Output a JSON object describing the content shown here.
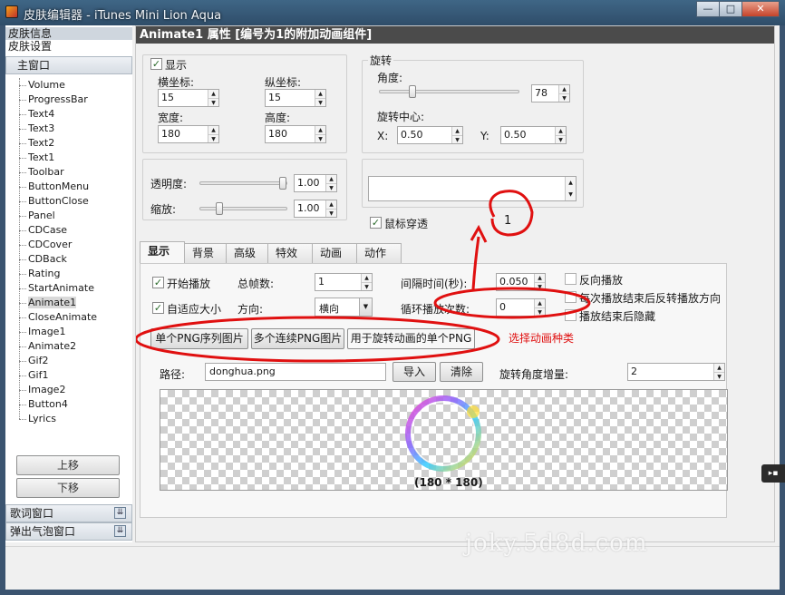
{
  "window": {
    "title": "皮肤编辑器 - iTunes Mini Lion Aqua",
    "buttons": {
      "minimize": "—",
      "maximize": "□",
      "close": "✕"
    }
  },
  "left": {
    "categories": [
      "皮肤信息",
      "皮肤设置"
    ],
    "main_group": "主窗口",
    "tree_items": [
      "Volume",
      "ProgressBar",
      "Text4",
      "Text3",
      "Text2",
      "Text1",
      "Toolbar",
      "ButtonMenu",
      "ButtonClose",
      "Panel",
      "CDCase",
      "CDCover",
      "CDBack",
      "Rating",
      "StartAnimate",
      "Animate1",
      "CloseAnimate",
      "Image1",
      "Animate2",
      "Gif2",
      "Gif1",
      "Image2",
      "Button4",
      "Lyrics"
    ],
    "selected_item": "Animate1",
    "move_up": "上移",
    "move_down": "下移",
    "lyrics_window": "歌词窗口",
    "bubble_window": "弹出气泡窗口"
  },
  "props": {
    "header": "Animate1 属性 [编号为1的附加动画组件]",
    "display_check": "显示",
    "x_label": "横坐标:",
    "x_value": "15",
    "y_label": "纵坐标:",
    "y_value": "15",
    "w_label": "宽度:",
    "w_value": "180",
    "h_label": "高度:",
    "h_value": "180",
    "rotate_group": "旋转",
    "angle_label": "角度:",
    "angle_value": "78",
    "angle_level": 0.22,
    "center_label": "旋转中心:",
    "cx_label": "X:",
    "cx_value": "0.50",
    "cy_label": "Y:",
    "cy_value": "0.50",
    "opacity_label": "透明度:",
    "opacity_value": "1.00",
    "opacity_level": 1.0,
    "scale_label": "缩放:",
    "scale_value": "1.00",
    "scale_level": 0.2,
    "mouse_through": "鼠标穿透"
  },
  "tabs": [
    "显示",
    "背景",
    "高级",
    "特效",
    "动画",
    "动作"
  ],
  "active_tab": "显示",
  "anim": {
    "autoplay": "开始播放",
    "total_frames_label": "总帧数:",
    "total_frames": "1",
    "interval_label": "间隔时间(秒):",
    "interval": "0.050",
    "reverse": "反向播放",
    "autosize": "自适应大小",
    "direction_label": "方向:",
    "direction": "横向",
    "loop_label": "循环播放次数:",
    "loop": "0",
    "reverse_after": "每次播放结束后反转播放方向",
    "hide_after": "播放结束后隐藏",
    "type_buttons": [
      "单个PNG序列图片",
      "多个连续PNG图片",
      "用于旋转动画的单个PNG"
    ],
    "path_label": "路径:",
    "path": "donghua.png",
    "import": "导入",
    "clear": "清除",
    "angle_inc_label": "旋转角度增量:",
    "angle_inc": "2",
    "size_caption": "(180 * 180)"
  },
  "annotations": {
    "number": "1",
    "type_note": "选择动画种类",
    "watermark": "joky.5d8d.com"
  },
  "colors": {
    "accent": "#e01010",
    "title_bar": "#3a5a78",
    "header": "#4b4b4b"
  }
}
